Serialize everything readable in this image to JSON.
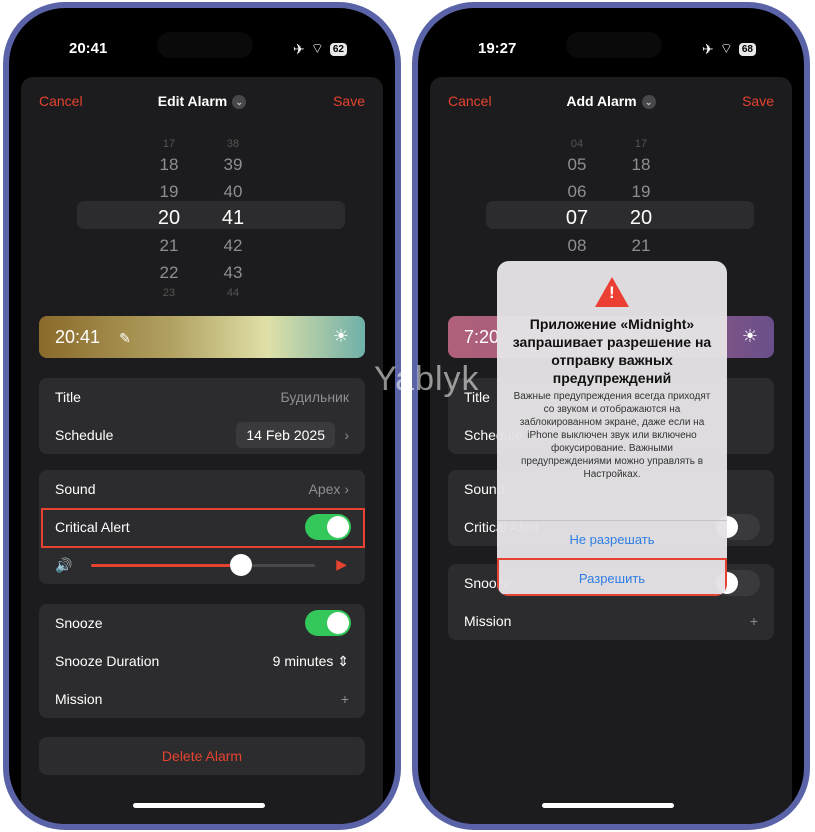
{
  "watermark": "Yablyk",
  "left": {
    "status": {
      "time": "20:41",
      "battery": "62"
    },
    "nav": {
      "cancel": "Cancel",
      "title": "Edit Alarm",
      "save": "Save"
    },
    "picker": {
      "hours": [
        "17",
        "18",
        "19",
        "20",
        "21",
        "22",
        "23"
      ],
      "minutes": [
        "38",
        "39",
        "40",
        "41",
        "42",
        "43",
        "44"
      ]
    },
    "banner": {
      "time": "20:41"
    },
    "rows": {
      "title_label": "Title",
      "title_value": "Будильник",
      "schedule_label": "Schedule",
      "schedule_value": "14 Feb 2025",
      "sound_label": "Sound",
      "sound_value": "Apex",
      "critical_label": "Critical Alert",
      "critical_on": true,
      "volume": 0.67,
      "snooze_label": "Snooze",
      "snooze_on": true,
      "duration_label": "Snooze Duration",
      "duration_value": "9 minutes",
      "mission_label": "Mission"
    },
    "delete": "Delete Alarm"
  },
  "right": {
    "status": {
      "time": "19:27",
      "battery": "68"
    },
    "nav": {
      "cancel": "Cancel",
      "title": "Add Alarm",
      "save": "Save"
    },
    "picker": {
      "hours": [
        "04",
        "05",
        "06",
        "07",
        "08"
      ],
      "minutes": [
        "17",
        "18",
        "19",
        "20",
        "21"
      ]
    },
    "banner": {
      "time": "7:20"
    },
    "rows": {
      "title_label": "Title",
      "schedule_label": "Schedule",
      "sound_label": "Sound",
      "critical_label": "Critical Alert",
      "snooze_label": "Snooze",
      "mission_label": "Mission"
    },
    "dialog": {
      "title": "Приложение «Midnight» запрашивает разрешение на отправку важных предупреждений",
      "message": "Важные предупреждения всегда приходят со звуком и отображаются на заблокированном экране, даже если на iPhone выключен звук или включено фокусирование. Важными предупреждениями можно управлять в Настройках.",
      "deny": "Не разрешать",
      "allow": "Разрешить"
    }
  },
  "colors": {
    "accent": "#e5432f",
    "toggle": "#34c759",
    "link": "#2f7ee6"
  }
}
